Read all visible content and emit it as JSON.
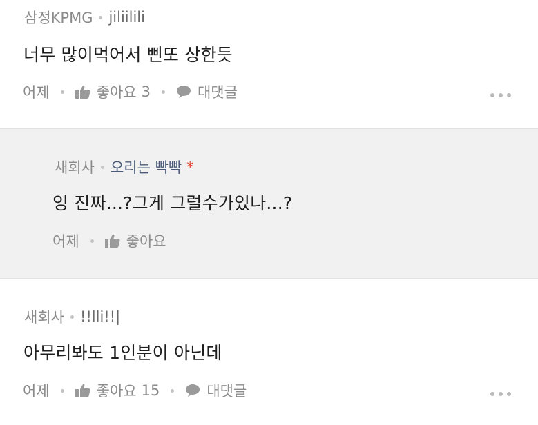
{
  "comments": [
    {
      "author_company": "삼정KPMG",
      "author_nick": "jiliilili",
      "text": "너무 많이먹어서 삔또 상한듯",
      "time": "어제",
      "like_label": "좋아요",
      "like_count": "3",
      "reply_label": "대댓글"
    },
    {
      "author_company": "새회사",
      "author_nick": "오리는 빡빡",
      "author_mark": "*",
      "text": "잉 진짜...?그게 그럴수가있나...?",
      "time": "어제",
      "like_label": "좋아요"
    },
    {
      "author_company": "새회사",
      "author_nick": "!!lli!!|",
      "text": "아무리봐도 1인분이 아닌데",
      "time": "어제",
      "like_label": "좋아요",
      "like_count": "15",
      "reply_label": "대댓글"
    }
  ],
  "icons": {
    "like": "thumbs-up-icon",
    "reply": "speech-bubble-icon",
    "more": "more-dots-icon"
  },
  "colors": {
    "meta_text": "#8b8b8b",
    "body_text": "#1e1e1e",
    "reply_background": "#f1f1f1",
    "author_mark": "#e0402a",
    "reply_nick": "#4a5a78"
  }
}
